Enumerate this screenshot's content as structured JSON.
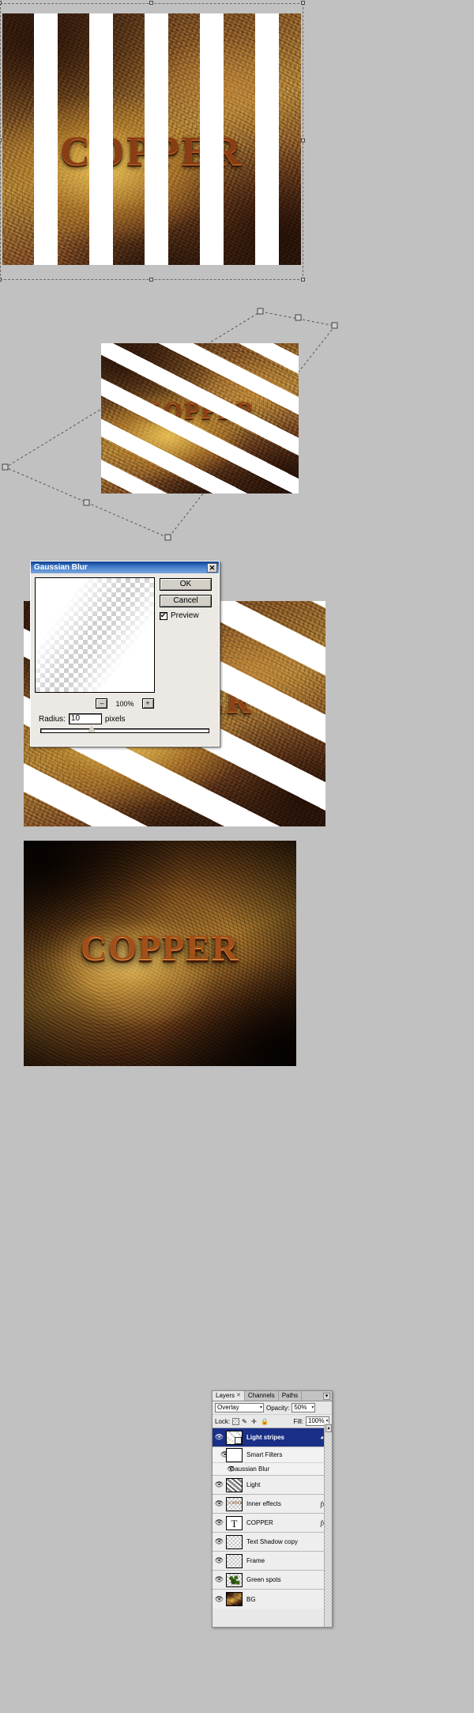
{
  "artwork": {
    "word": "COPPER"
  },
  "dialog": {
    "title": "Gaussian Blur",
    "close_label": "✕",
    "ok_label": "OK",
    "cancel_label": "Cancel",
    "preview_label": "Preview",
    "zoom_out_label": "–",
    "zoom_level": "100%",
    "zoom_in_label": "+",
    "radius_label": "Radius:",
    "radius_value": "10",
    "radius_units": "pixels"
  },
  "layers_panel": {
    "tabs": [
      {
        "label": "Layers",
        "close": "✕",
        "active": true
      },
      {
        "label": "Channels",
        "close": "",
        "active": false
      },
      {
        "label": "Paths",
        "close": "",
        "active": false
      }
    ],
    "menu_icon": "▾",
    "blend_mode": "Overlay",
    "opacity_label": "Opacity:",
    "opacity_value": "50%",
    "fill_label": "Fill:",
    "fill_value": "100%",
    "lock_label": "Lock:",
    "lock_icons": [
      "transparency-lock-icon",
      "pixels-lock-icon",
      "position-lock-icon",
      "all-lock-icon"
    ],
    "arrow": "▾",
    "eye_icon": "👁",
    "fx_label": "fx",
    "rows": [
      {
        "name": "Light stripes",
        "selected": true,
        "thumb": "stripes-smart",
        "fx": "",
        "tri": "",
        "mask": true,
        "indent": 0
      },
      {
        "name": "Smart Filters",
        "selected": false,
        "thumb": "mask-white",
        "fx": "",
        "tri": "",
        "mask": false,
        "indent": 1
      },
      {
        "name": "Gaussian Blur",
        "selected": false,
        "thumb": "none",
        "fx": "",
        "tri": "",
        "mask": false,
        "indent": 2,
        "settings_icon": "filter-settings-icon"
      },
      {
        "name": "Light",
        "selected": false,
        "thumb": "gradient-diag",
        "fx": "",
        "tri": "",
        "mask": false,
        "indent": 0
      },
      {
        "name": "Inner effects",
        "selected": false,
        "thumb": "checker-text",
        "fx": "fx",
        "tri": "▾",
        "mask": false,
        "indent": 0
      },
      {
        "name": "COPPER",
        "selected": false,
        "thumb": "type-T",
        "fx": "fx",
        "tri": "▾",
        "mask": false,
        "indent": 0
      },
      {
        "name": "Text Shadow copy",
        "selected": false,
        "thumb": "checker",
        "fx": "",
        "tri": "",
        "mask": false,
        "indent": 0
      },
      {
        "name": "Frame",
        "selected": false,
        "thumb": "checker",
        "fx": "",
        "tri": "",
        "mask": false,
        "indent": 0
      },
      {
        "name": "Green spots",
        "selected": false,
        "thumb": "green",
        "fx": "",
        "tri": "",
        "mask": false,
        "indent": 0
      },
      {
        "name": "BG",
        "selected": false,
        "thumb": "rust",
        "fx": "",
        "tri": "",
        "mask": false,
        "indent": 0
      }
    ]
  },
  "colors": {
    "accent": "#1a2f87",
    "titlebar": "#0b3f8f",
    "canvas_bg": "#c1c1c1",
    "copper": "#a24f19"
  }
}
